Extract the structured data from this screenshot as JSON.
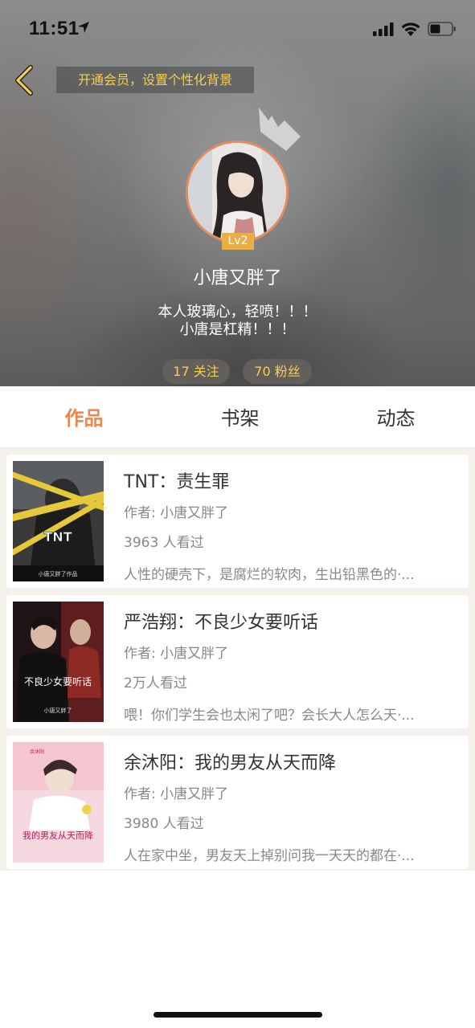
{
  "status_bar": {
    "time": "11:51"
  },
  "header": {
    "vip_banner": "开通会员，设置个性化背景",
    "level": "Lv2",
    "username": "小唐又胖了",
    "bio_lines": [
      "本人玻璃心，轻喷！！！",
      "小唐是杠精！！！"
    ],
    "following": "17 关注",
    "fans": "70 粉丝"
  },
  "tabs": [
    {
      "label": "作品",
      "active": true
    },
    {
      "label": "书架",
      "active": false
    },
    {
      "label": "动态",
      "active": false
    }
  ],
  "books": [
    {
      "title": "TNT：责生罪",
      "author": "作者: 小唐又胖了",
      "reads": "3963 人看过",
      "desc": "人性的硬壳下，是腐烂的软肉，生出铅黑色的·...",
      "cover_text": "TNT",
      "cover_subtitle": "小唐又胖了作品"
    },
    {
      "title": "严浩翔：不良少女要听话",
      "author": "作者: 小唐又胖了",
      "reads": "2万人看过",
      "desc": "喂！你们学生会也太闲了吧？会长大人怎么天·...",
      "cover_text": "不良少女要听话",
      "cover_subtitle": "小唐又胖了"
    },
    {
      "title": "余沐阳：我的男友从天而降",
      "author": "作者: 小唐又胖了",
      "reads": "3980 人看过",
      "desc": "人在家中坐，男友天上掉别问我一天天的都在·...",
      "cover_text": "我的男友从天而降",
      "cover_subtitle": "余沐阳"
    }
  ],
  "colors": {
    "accent": "#e8884f",
    "gold": "#f4cf57",
    "level_badge": "#e8ae4a"
  }
}
